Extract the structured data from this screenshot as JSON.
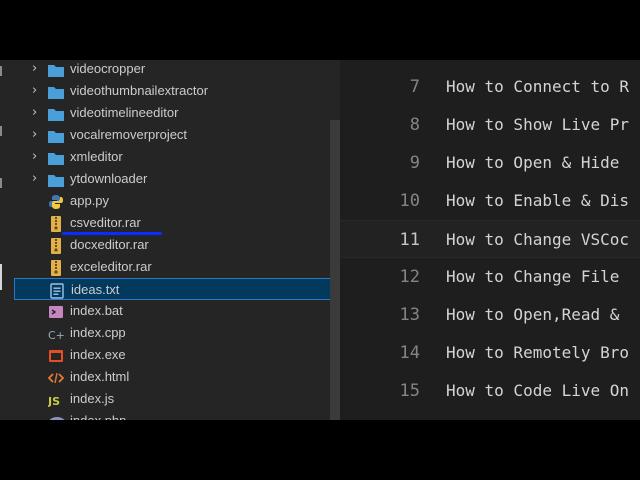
{
  "explorer": {
    "items": [
      {
        "label": "videocropper",
        "kind": "folder",
        "icon": "folder-icon",
        "expandable": true
      },
      {
        "label": "videothumbnailextractor",
        "kind": "folder",
        "icon": "folder-icon",
        "expandable": true
      },
      {
        "label": "videotimelineeditor",
        "kind": "folder",
        "icon": "folder-icon",
        "expandable": true
      },
      {
        "label": "vocalremoverproject",
        "kind": "folder",
        "icon": "folder-icon",
        "expandable": true
      },
      {
        "label": "xmleditor",
        "kind": "folder",
        "icon": "folder-icon",
        "expandable": true
      },
      {
        "label": "ytdownloader",
        "kind": "folder",
        "icon": "folder-icon",
        "expandable": true
      },
      {
        "label": "app.py",
        "kind": "file",
        "icon": "python-file-icon"
      },
      {
        "label": "csveditor.rar",
        "kind": "file",
        "icon": "archive-file-icon"
      },
      {
        "label": "docxeditor.rar",
        "kind": "file",
        "icon": "archive-file-icon"
      },
      {
        "label": "exceleditor.rar",
        "kind": "file",
        "icon": "archive-file-icon"
      },
      {
        "label": "ideas.txt",
        "kind": "file",
        "icon": "text-file-icon",
        "selected": true
      },
      {
        "label": "index.bat",
        "kind": "file",
        "icon": "batch-file-icon"
      },
      {
        "label": "index.cpp",
        "kind": "file",
        "icon": "cpp-file-icon"
      },
      {
        "label": "index.exe",
        "kind": "file",
        "icon": "exe-file-icon"
      },
      {
        "label": "index.html",
        "kind": "file",
        "icon": "html-file-icon"
      },
      {
        "label": "index.js",
        "kind": "file",
        "icon": "js-file-icon"
      },
      {
        "label": "index.php",
        "kind": "file",
        "icon": "php-file-icon"
      }
    ]
  },
  "editor": {
    "current_line": 11,
    "lines": [
      {
        "number": "7",
        "text": "How to Connect to R"
      },
      {
        "number": "8",
        "text": "How to Show Live Pr"
      },
      {
        "number": "9",
        "text": "How to Open & Hide"
      },
      {
        "number": "10",
        "text": "How to Enable & Dis"
      },
      {
        "number": "11",
        "text": "How to Change VSCoc"
      },
      {
        "number": "12",
        "text": "How to Change File"
      },
      {
        "number": "13",
        "text": "How to Open,Read &"
      },
      {
        "number": "14",
        "text": "How to Remotely Bro"
      },
      {
        "number": "15",
        "text": "How to Code Live On"
      }
    ]
  },
  "colors": {
    "folder": "#4a9fd8",
    "archive": "#e2b04a",
    "python_blue": "#3f78b0",
    "python_yellow": "#f3c93d",
    "selection_bg": "#04395e",
    "annotation_underline": "#0b2cff"
  }
}
